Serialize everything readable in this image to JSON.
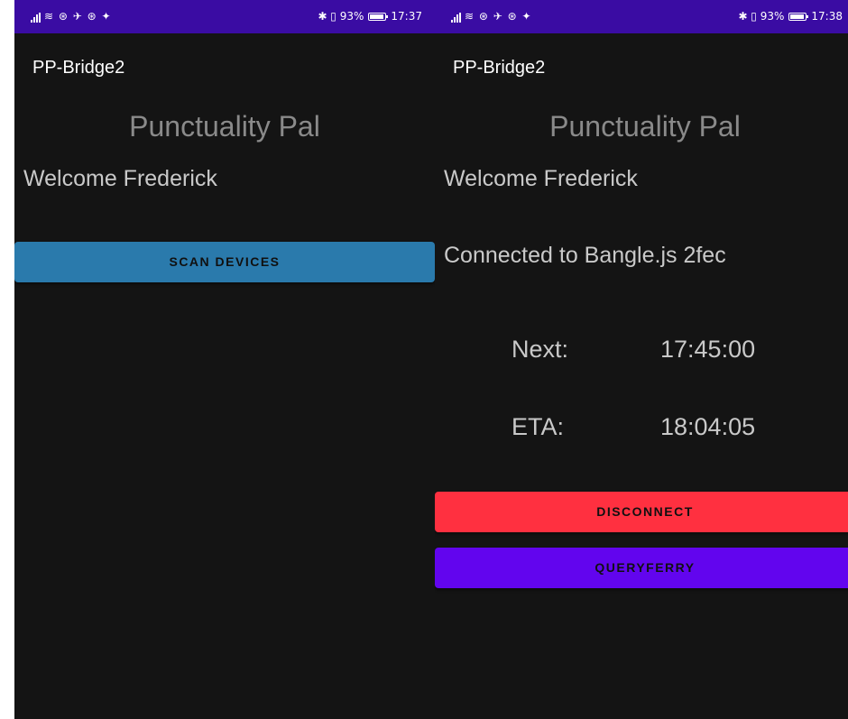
{
  "left_screen": {
    "status": {
      "left_icons": "≋ ⊛ ✈ ⊛ ✦",
      "right_text": "✱ ▯ 93%",
      "time": "17:37",
      "battery_level": 0.93
    },
    "app_title": "PP-Bridge2",
    "heading": "Punctuality Pal",
    "welcome": "Welcome Frederick",
    "scan_button": "SCAN DEVICES"
  },
  "right_screen": {
    "status": {
      "left_icons": "≋ ⊛ ✈ ⊛ ✦",
      "right_text": "✱ ▯ 93%",
      "time": "17:38",
      "battery_level": 0.93
    },
    "app_title": "PP-Bridge2",
    "heading": "Punctuality Pal",
    "welcome": "Welcome Frederick",
    "connected_text": "Connected to Bangle.js 2fec",
    "next_label": "Next:",
    "next_value": "17:45:00",
    "eta_label": "ETA:",
    "eta_value": "18:04:05",
    "disconnect_button": "DISCONNECT",
    "query_button": "QUERYFERRY"
  },
  "colors": {
    "background": "#141414",
    "status_bar": "#3a0ca3",
    "scan_button": "#2a7aac",
    "disconnect_button": "#ff3040",
    "query_button": "#6205ee"
  }
}
